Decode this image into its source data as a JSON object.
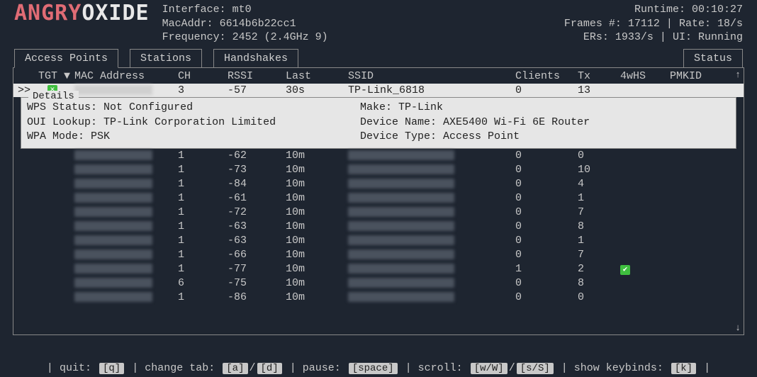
{
  "app": {
    "name_a": "ANGRY",
    "name_b": "OXIDE"
  },
  "header": {
    "interface_label": "Interface:",
    "interface": "mt0",
    "mac_label": "MacAddr:",
    "mac": "6614b6b22cc1",
    "freq_label": "Frequency:",
    "freq": "2452 (2.4GHz 9)",
    "runtime_label": "Runtime:",
    "runtime": "00:10:27",
    "frames_label": "Frames #:",
    "frames": "17112",
    "rate_label": "Rate:",
    "rate": "18/s",
    "ers_label": "ERs:",
    "ers": "1933/s",
    "ui_label": "UI:",
    "ui": "Running"
  },
  "tabs": {
    "ap": "Access Points",
    "stations": "Stations",
    "handshakes": "Handshakes",
    "status": "Status"
  },
  "columns": {
    "tgt": "TGT ▼",
    "mac": "MAC Address",
    "ch": "CH",
    "rssi": "RSSI",
    "last": "Last",
    "ssid": "SSID",
    "clients": "Clients",
    "tx": "Tx",
    "whs": "4wHS",
    "pmkid": "PMKID"
  },
  "selected_row": {
    "indicator": ">>",
    "ch": "3",
    "rssi": "-57",
    "last": "30s",
    "ssid": "TP-Link_6818",
    "clients": "0",
    "tx": "13"
  },
  "details": {
    "title": "Details",
    "wps_label": "WPS Status:",
    "wps": "Not Configured",
    "oui_label": "OUI Lookup:",
    "oui": "TP-Link Corporation Limited",
    "wpa_label": "WPA Mode:",
    "wpa": "PSK",
    "make_label": "Make:",
    "make": "TP-Link",
    "devname_label": "Device Name:",
    "devname": "AXE5400 Wi-Fi 6E Router",
    "devtype_label": "Device Type:",
    "devtype": "Access Point"
  },
  "rows": [
    {
      "ch": "1",
      "rssi": "-62",
      "last": "10m",
      "clients": "0",
      "tx": "0",
      "whs": false
    },
    {
      "ch": "1",
      "rssi": "-73",
      "last": "10m",
      "clients": "0",
      "tx": "10",
      "whs": false
    },
    {
      "ch": "1",
      "rssi": "-84",
      "last": "10m",
      "clients": "0",
      "tx": "4",
      "whs": false
    },
    {
      "ch": "1",
      "rssi": "-61",
      "last": "10m",
      "clients": "0",
      "tx": "1",
      "whs": false
    },
    {
      "ch": "1",
      "rssi": "-72",
      "last": "10m",
      "clients": "0",
      "tx": "7",
      "whs": false
    },
    {
      "ch": "1",
      "rssi": "-63",
      "last": "10m",
      "clients": "0",
      "tx": "8",
      "whs": false
    },
    {
      "ch": "1",
      "rssi": "-63",
      "last": "10m",
      "clients": "0",
      "tx": "1",
      "whs": false
    },
    {
      "ch": "1",
      "rssi": "-66",
      "last": "10m",
      "clients": "0",
      "tx": "7",
      "whs": false
    },
    {
      "ch": "1",
      "rssi": "-77",
      "last": "10m",
      "clients": "1",
      "tx": "2",
      "whs": true
    },
    {
      "ch": "6",
      "rssi": "-75",
      "last": "10m",
      "clients": "0",
      "tx": "8",
      "whs": false
    },
    {
      "ch": "1",
      "rssi": "-86",
      "last": "10m",
      "clients": "0",
      "tx": "0",
      "whs": false
    }
  ],
  "footer": {
    "quit": "quit:",
    "quit_key": "[q]",
    "change": "change tab:",
    "change_key1": "[a]",
    "change_sep": "/",
    "change_key2": "[d]",
    "pause": "pause:",
    "pause_key": "[space]",
    "scroll": "scroll:",
    "scroll_key1": "[w/W]",
    "scroll_sep": "/",
    "scroll_key2": "[s/S]",
    "show": "show keybinds:",
    "show_key": "[k]",
    "sep": "|"
  }
}
